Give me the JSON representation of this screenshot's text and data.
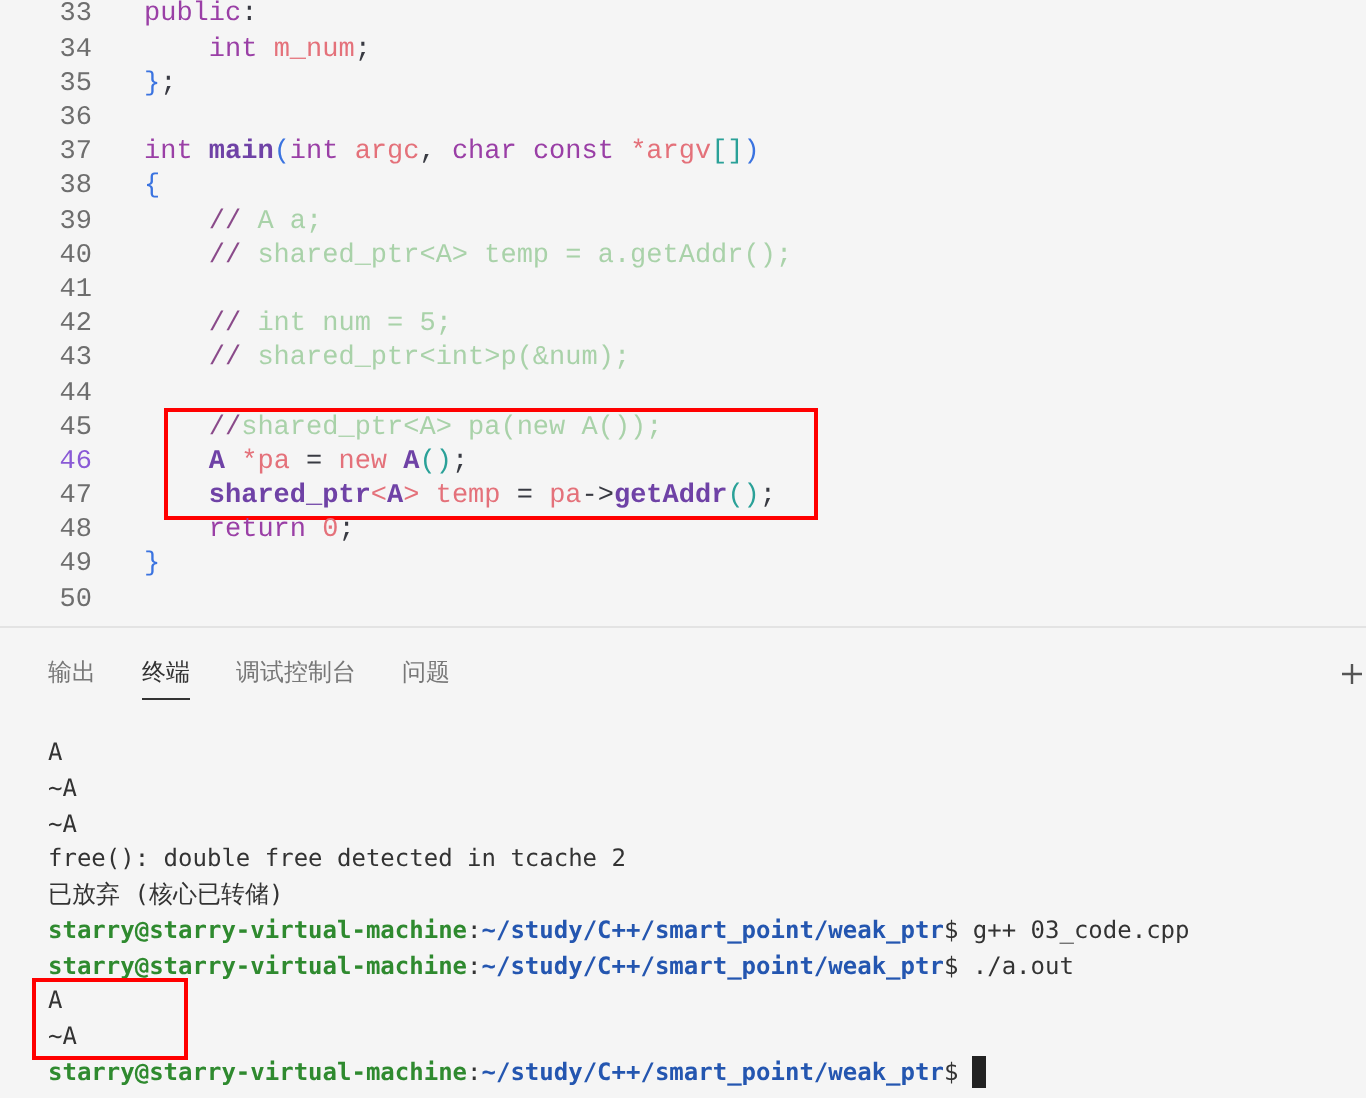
{
  "editor": {
    "lines": [
      {
        "number": "33",
        "current": false,
        "boxed": false,
        "tokens": [
          {
            "text": "public",
            "kind": "kw"
          },
          {
            "text": ":",
            "kind": "punct"
          }
        ]
      },
      {
        "number": "34",
        "current": false,
        "boxed": false,
        "tokens": [
          {
            "text": "    int",
            "kind": "kw"
          },
          {
            "text": " m_num",
            "kind": "name"
          },
          {
            "text": ";",
            "kind": "punct"
          }
        ]
      },
      {
        "number": "35",
        "current": false,
        "boxed": false,
        "tokens": [
          {
            "text": "}",
            "kind": "brace"
          },
          {
            "text": ";",
            "kind": "punct"
          }
        ]
      },
      {
        "number": "36",
        "current": false,
        "boxed": false
      },
      {
        "number": "37",
        "current": false,
        "boxed": false,
        "tokens": [
          {
            "text": "int ",
            "kind": "kw"
          },
          {
            "text": "main",
            "kind": "fn"
          },
          {
            "text": "(",
            "kind": "brace"
          },
          {
            "text": "int ",
            "kind": "kw"
          },
          {
            "text": "argc",
            "kind": "name"
          },
          {
            "text": ", ",
            "kind": "punct"
          },
          {
            "text": "char const ",
            "kind": "kw"
          },
          {
            "text": "*argv",
            "kind": "name"
          },
          {
            "text": "[]",
            "kind": "paren"
          },
          {
            "text": ")",
            "kind": "brace"
          }
        ]
      },
      {
        "number": "38",
        "current": false,
        "boxed": false,
        "tokens": [
          {
            "text": "{",
            "kind": "brace"
          }
        ]
      },
      {
        "number": "39",
        "current": false,
        "boxed": false,
        "tokens": [
          {
            "text": "    //",
            "kind": "slash"
          },
          {
            "text": " A a;",
            "kind": "comment"
          }
        ]
      },
      {
        "number": "40",
        "current": false,
        "boxed": false,
        "tokens": [
          {
            "text": "    //",
            "kind": "slash"
          },
          {
            "text": " shared_ptr<A> temp = a.getAddr();",
            "kind": "comment"
          }
        ]
      },
      {
        "number": "41",
        "current": false,
        "boxed": false
      },
      {
        "number": "42",
        "current": false,
        "boxed": false,
        "tokens": [
          {
            "text": "    //",
            "kind": "slash"
          },
          {
            "text": " int num = 5;",
            "kind": "comment"
          }
        ]
      },
      {
        "number": "43",
        "current": false,
        "boxed": false,
        "tokens": [
          {
            "text": "    //",
            "kind": "slash"
          },
          {
            "text": " shared_ptr<int>p(&num);",
            "kind": "comment"
          }
        ]
      },
      {
        "number": "44",
        "current": false,
        "boxed": false
      },
      {
        "number": "45",
        "current": false,
        "boxed": true,
        "tokens": [
          {
            "text": "    //",
            "kind": "slash"
          },
          {
            "text": "shared_ptr<A> pa(new A());",
            "kind": "comment"
          }
        ]
      },
      {
        "number": "46",
        "current": true,
        "boxed": true,
        "tokens": [
          {
            "text": "    A",
            "kind": "type"
          },
          {
            "text": " *pa",
            "kind": "name"
          },
          {
            "text": " = ",
            "kind": "punct"
          },
          {
            "text": "new",
            "kind": "name"
          },
          {
            "text": " A",
            "kind": "type"
          },
          {
            "text": "()",
            "kind": "paren"
          },
          {
            "text": ";",
            "kind": "punct"
          }
        ]
      },
      {
        "number": "47",
        "current": false,
        "boxed": true,
        "tokens": [
          {
            "text": "    shared_ptr",
            "kind": "type"
          },
          {
            "text": "<",
            "kind": "name"
          },
          {
            "text": "A",
            "kind": "type"
          },
          {
            "text": ">",
            "kind": "name"
          },
          {
            "text": " temp",
            "kind": "name"
          },
          {
            "text": " = ",
            "kind": "punct"
          },
          {
            "text": "pa",
            "kind": "name"
          },
          {
            "text": "->",
            "kind": "punct"
          },
          {
            "text": "getAddr",
            "kind": "fn"
          },
          {
            "text": "()",
            "kind": "paren"
          },
          {
            "text": ";",
            "kind": "punct"
          }
        ]
      },
      {
        "number": "48",
        "current": false,
        "boxed": false,
        "tokens": [
          {
            "text": "    return ",
            "kind": "kw"
          },
          {
            "text": "0",
            "kind": "name"
          },
          {
            "text": ";",
            "kind": "punct"
          }
        ]
      },
      {
        "number": "49",
        "current": false,
        "boxed": false,
        "tokens": [
          {
            "text": "}",
            "kind": "brace"
          }
        ]
      },
      {
        "number": "50",
        "current": false,
        "boxed": false
      }
    ]
  },
  "panel": {
    "tabs": [
      {
        "label": "输出",
        "selected": false
      },
      {
        "label": "终端",
        "selected": true
      },
      {
        "label": "调试控制台",
        "selected": false
      },
      {
        "label": "问题",
        "selected": false
      }
    ],
    "terminal": [
      {
        "boxed": false,
        "cursor": false,
        "tokens": [
          {
            "text": "A",
            "kind": "plain"
          }
        ]
      },
      {
        "boxed": false,
        "cursor": false,
        "tokens": [
          {
            "text": "~A",
            "kind": "plain"
          }
        ]
      },
      {
        "boxed": false,
        "cursor": false,
        "tokens": [
          {
            "text": "~A",
            "kind": "plain"
          }
        ]
      },
      {
        "boxed": false,
        "cursor": false,
        "tokens": [
          {
            "text": "free(): double free detected in tcache 2",
            "kind": "plain"
          }
        ]
      },
      {
        "boxed": false,
        "cursor": false,
        "tokens": [
          {
            "text": "已放弃 (核心已转储)",
            "kind": "plain"
          }
        ]
      },
      {
        "boxed": false,
        "cursor": false,
        "tokens": [
          {
            "text": "starry@starry-virtual-machine",
            "kind": "user"
          },
          {
            "text": ":",
            "kind": "plain"
          },
          {
            "text": "~/study/C++/smart_point/weak_ptr",
            "kind": "path"
          },
          {
            "text": "$ g++ 03_code.cpp",
            "kind": "plain"
          }
        ]
      },
      {
        "boxed": false,
        "cursor": false,
        "tokens": [
          {
            "text": "starry@starry-virtual-machine",
            "kind": "user"
          },
          {
            "text": ":",
            "kind": "plain"
          },
          {
            "text": "~/study/C++/smart_point/weak_ptr",
            "kind": "path"
          },
          {
            "text": "$ ./a.out",
            "kind": "plain"
          }
        ]
      },
      {
        "boxed": true,
        "cursor": false,
        "tokens": [
          {
            "text": "A",
            "kind": "plain"
          }
        ]
      },
      {
        "boxed": true,
        "cursor": false,
        "tokens": [
          {
            "text": "~A",
            "kind": "plain"
          }
        ]
      },
      {
        "boxed": false,
        "cursor": true,
        "tokens": [
          {
            "text": "starry@starry-virtual-machine",
            "kind": "user"
          },
          {
            "text": ":",
            "kind": "plain"
          },
          {
            "text": "~/study/C++/smart_point/weak_ptr",
            "kind": "path"
          },
          {
            "text": "$",
            "kind": "plain"
          }
        ]
      }
    ]
  }
}
